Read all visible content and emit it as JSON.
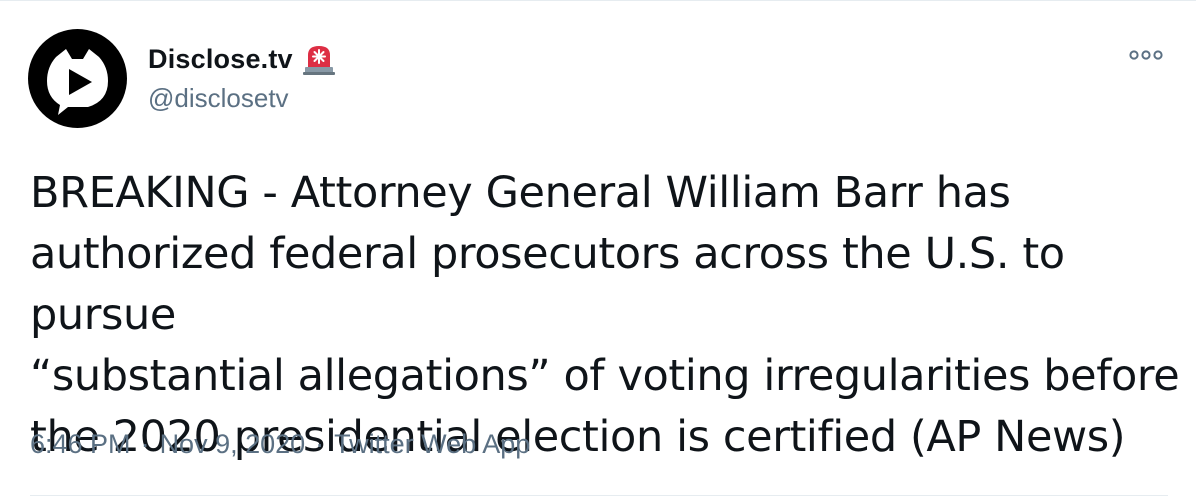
{
  "author": {
    "display_name": "Disclose.tv",
    "handle": "@disclosetv",
    "emoji_icon": "rotating-light-siren-icon"
  },
  "tweet": {
    "lines": [
      "BREAKING - Attorney General William Barr has",
      "authorized federal prosecutors across the U.S. to pursue",
      "“substantial allegations” of voting irregularities before",
      "the 2020 presidential election is certified (AP News)"
    ]
  },
  "meta": {
    "time": "6:46 PM",
    "separator": "·",
    "date": "Nov 9, 2020",
    "source": "Twitter Web App"
  },
  "colors": {
    "text": "#0f1419",
    "secondary": "#5b7083",
    "divider": "#e6ecf0",
    "siren_red": "#e0245e"
  }
}
